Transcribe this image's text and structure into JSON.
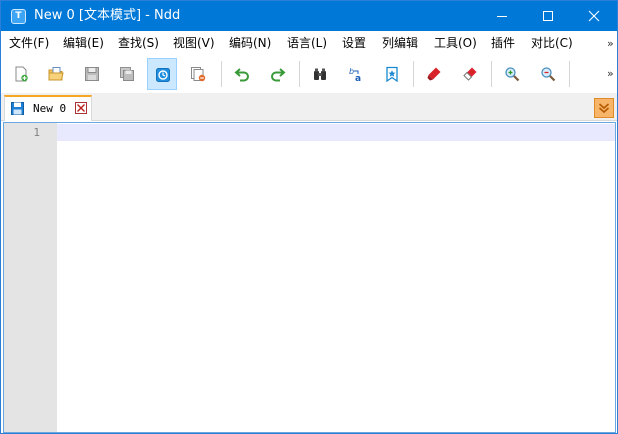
{
  "window": {
    "title": "New 0 [文本模式] - Ndd",
    "icon_letter": "T"
  },
  "menu": {
    "items": [
      "文件(F)",
      "编辑(E)",
      "查找(S)",
      "视图(V)",
      "编码(N)",
      "语言(L)",
      "设置",
      "列编辑",
      "工具(O)",
      "插件",
      "对比(C)"
    ],
    "more": "»"
  },
  "toolbar": {
    "more": "»",
    "buttons": [
      {
        "name": "new-file",
        "icon": "new-file-icon"
      },
      {
        "name": "open-file",
        "icon": "open-folder-icon"
      },
      {
        "name": "save",
        "icon": "save-icon"
      },
      {
        "name": "save-all",
        "icon": "save-all-icon"
      },
      {
        "name": "auto-save",
        "icon": "auto-save-icon",
        "active": true
      },
      {
        "name": "close-file",
        "icon": "close-file-icon"
      },
      {
        "name": "undo",
        "icon": "undo-icon"
      },
      {
        "name": "redo",
        "icon": "redo-icon"
      },
      {
        "name": "find",
        "icon": "binoculars-icon"
      },
      {
        "name": "replace",
        "icon": "replace-icon"
      },
      {
        "name": "bookmark",
        "icon": "bookmark-icon"
      },
      {
        "name": "mark",
        "icon": "marker-icon"
      },
      {
        "name": "clear-mark",
        "icon": "eraser-icon"
      },
      {
        "name": "zoom-in",
        "icon": "zoom-in-icon"
      },
      {
        "name": "zoom-out",
        "icon": "zoom-out-icon"
      }
    ]
  },
  "tabs": [
    {
      "label": "New 0",
      "active": true
    }
  ],
  "editor": {
    "line_numbers": [
      "1"
    ],
    "content": ""
  },
  "colors": {
    "titlebar": "#0078d7",
    "tab_accent": "#f5a623",
    "current_line": "#e8e8ff",
    "active_button": "#cce8ff"
  }
}
